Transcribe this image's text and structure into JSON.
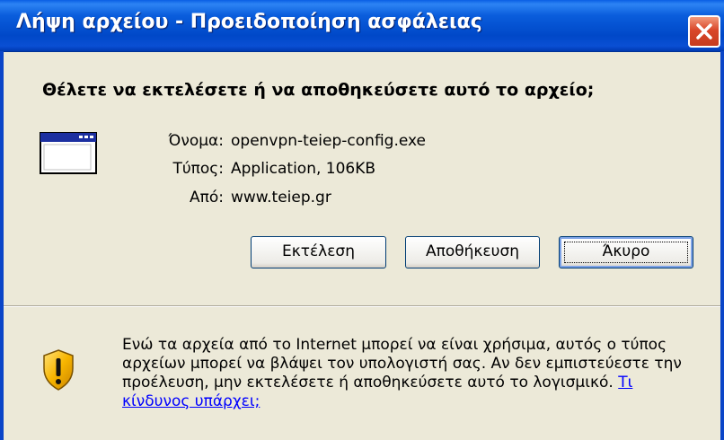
{
  "window": {
    "title": "Λήψη αρχείου - Προειδοποίηση ασφάλειας",
    "close_icon": "close-icon"
  },
  "dialog": {
    "question": "Θέλετε να εκτελέσετε ή να αποθηκεύσετε αυτό το αρχείο;",
    "file_icon": "application-window-icon",
    "fields": [
      {
        "label": "Όνομα:",
        "value": "openvpn-teiep-config.exe"
      },
      {
        "label": "Τύπος:",
        "value": "Application, 106KB"
      },
      {
        "label": "Από:",
        "value": "www.teiep.gr"
      }
    ],
    "buttons": {
      "run": "Εκτέλεση",
      "save": "Αποθήκευση",
      "cancel": "Άκυρο"
    }
  },
  "warning": {
    "icon": "shield-warning-icon",
    "text": "Ενώ τα αρχεία από το Internet μπορεί να είναι χρήσιμα, αυτός ο τύπος αρχείων μπορεί να βλάψει τον υπολογιστή σας. Αν δεν εμπιστεύεστε την προέλευση, μην εκτελέσετε ή αποθηκεύσετε αυτό το λογισμικό.",
    "link": "Τι κίνδυνος υπάρχει;"
  }
}
